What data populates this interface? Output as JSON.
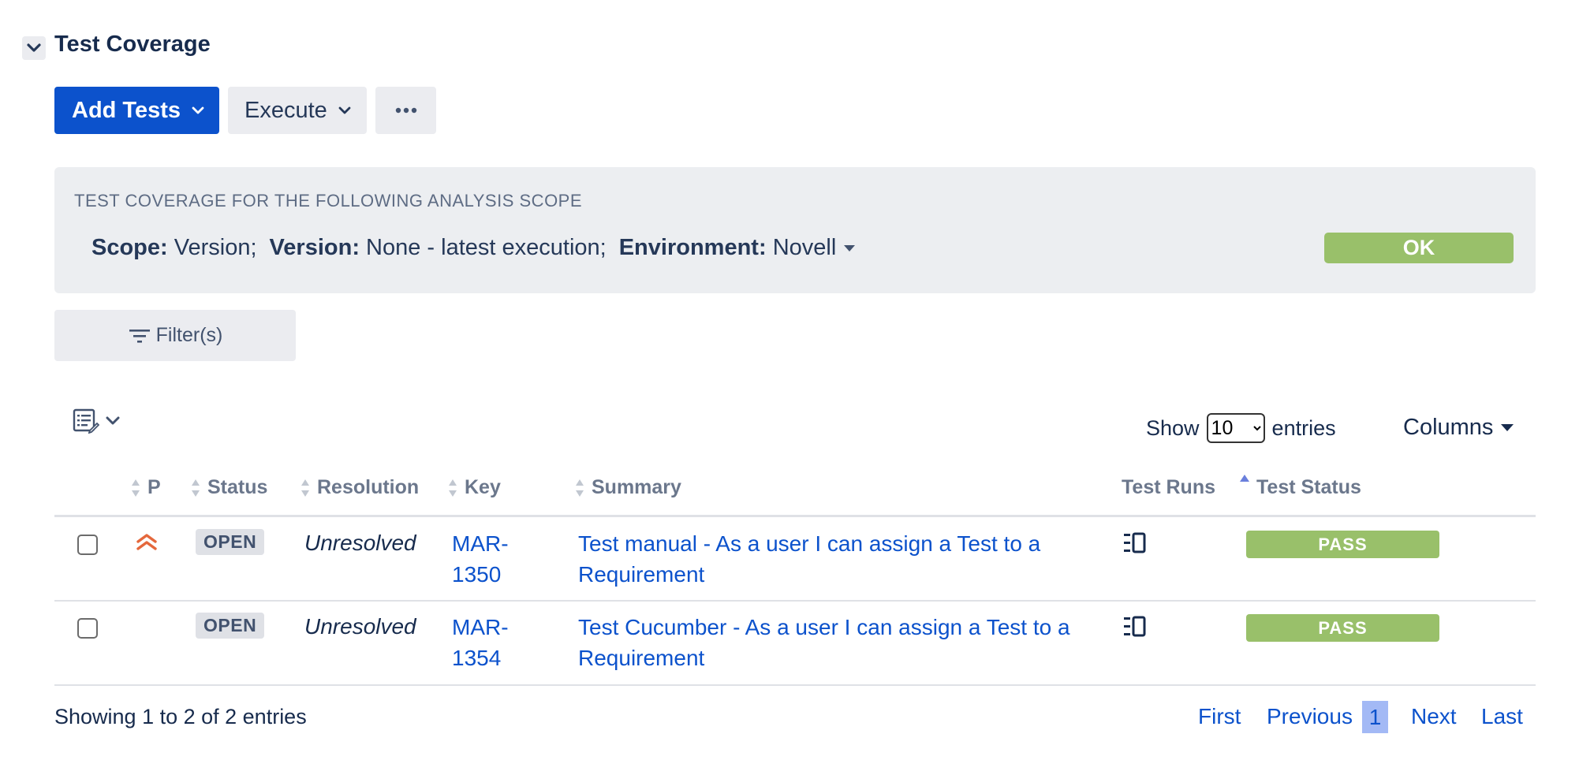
{
  "section": {
    "title": "Test Coverage"
  },
  "toolbar": {
    "add_tests": "Add Tests",
    "execute": "Execute",
    "more": "···"
  },
  "scope": {
    "heading": "TEST COVERAGE FOR THE FOLLOWING ANALYSIS SCOPE",
    "scope_label": "Scope:",
    "scope_value": "Version;",
    "version_label": "Version:",
    "version_value": "None - latest execution;",
    "environment_label": "Environment:",
    "environment_value": "Novell",
    "ok_label": "OK"
  },
  "filters": {
    "label": "Filter(s)"
  },
  "table_controls": {
    "show_label": "Show",
    "page_size": "10",
    "page_size_options": [
      "10"
    ],
    "entries_label": "entries",
    "columns_label": "Columns"
  },
  "table": {
    "headers": {
      "priority": "P",
      "status": "Status",
      "resolution": "Resolution",
      "key": "Key",
      "summary": "Summary",
      "test_runs": "Test Runs",
      "test_status": "Test Status"
    },
    "rows": [
      {
        "priority": "highest",
        "status": "OPEN",
        "resolution": "Unresolved",
        "key_line1": "MAR-",
        "key_line2": "1350",
        "summary_line1": "Test manual - As a user I can assign a Test to a",
        "summary_line2": "Requirement",
        "test_status": "PASS"
      },
      {
        "priority": "",
        "status": "OPEN",
        "resolution": "Unresolved",
        "key_line1": "MAR-",
        "key_line2": "1354",
        "summary_line1": "Test Cucumber - As a user I can assign a Test to a",
        "summary_line2": "Requirement",
        "test_status": "PASS"
      }
    ]
  },
  "footer": {
    "showing": "Showing 1 to 2 of 2 entries",
    "first": "First",
    "previous": "Previous",
    "current_page": "1",
    "next": "Next",
    "last": "Last"
  },
  "colors": {
    "primary": "#0c52cc",
    "pass": "#99c06a",
    "priority_highest": "#e5683c",
    "panel": "#eceef1",
    "lozenge": "#dfe1e6",
    "current_page": "#a3b9f5"
  },
  "icons": {
    "collapse": "chevron-down-icon",
    "filter": "filter-icon",
    "list_edit": "list-edit-icon",
    "test_runs": "test-runs-icon",
    "priority": "priority-highest-icon",
    "sort": "sort-icon"
  }
}
